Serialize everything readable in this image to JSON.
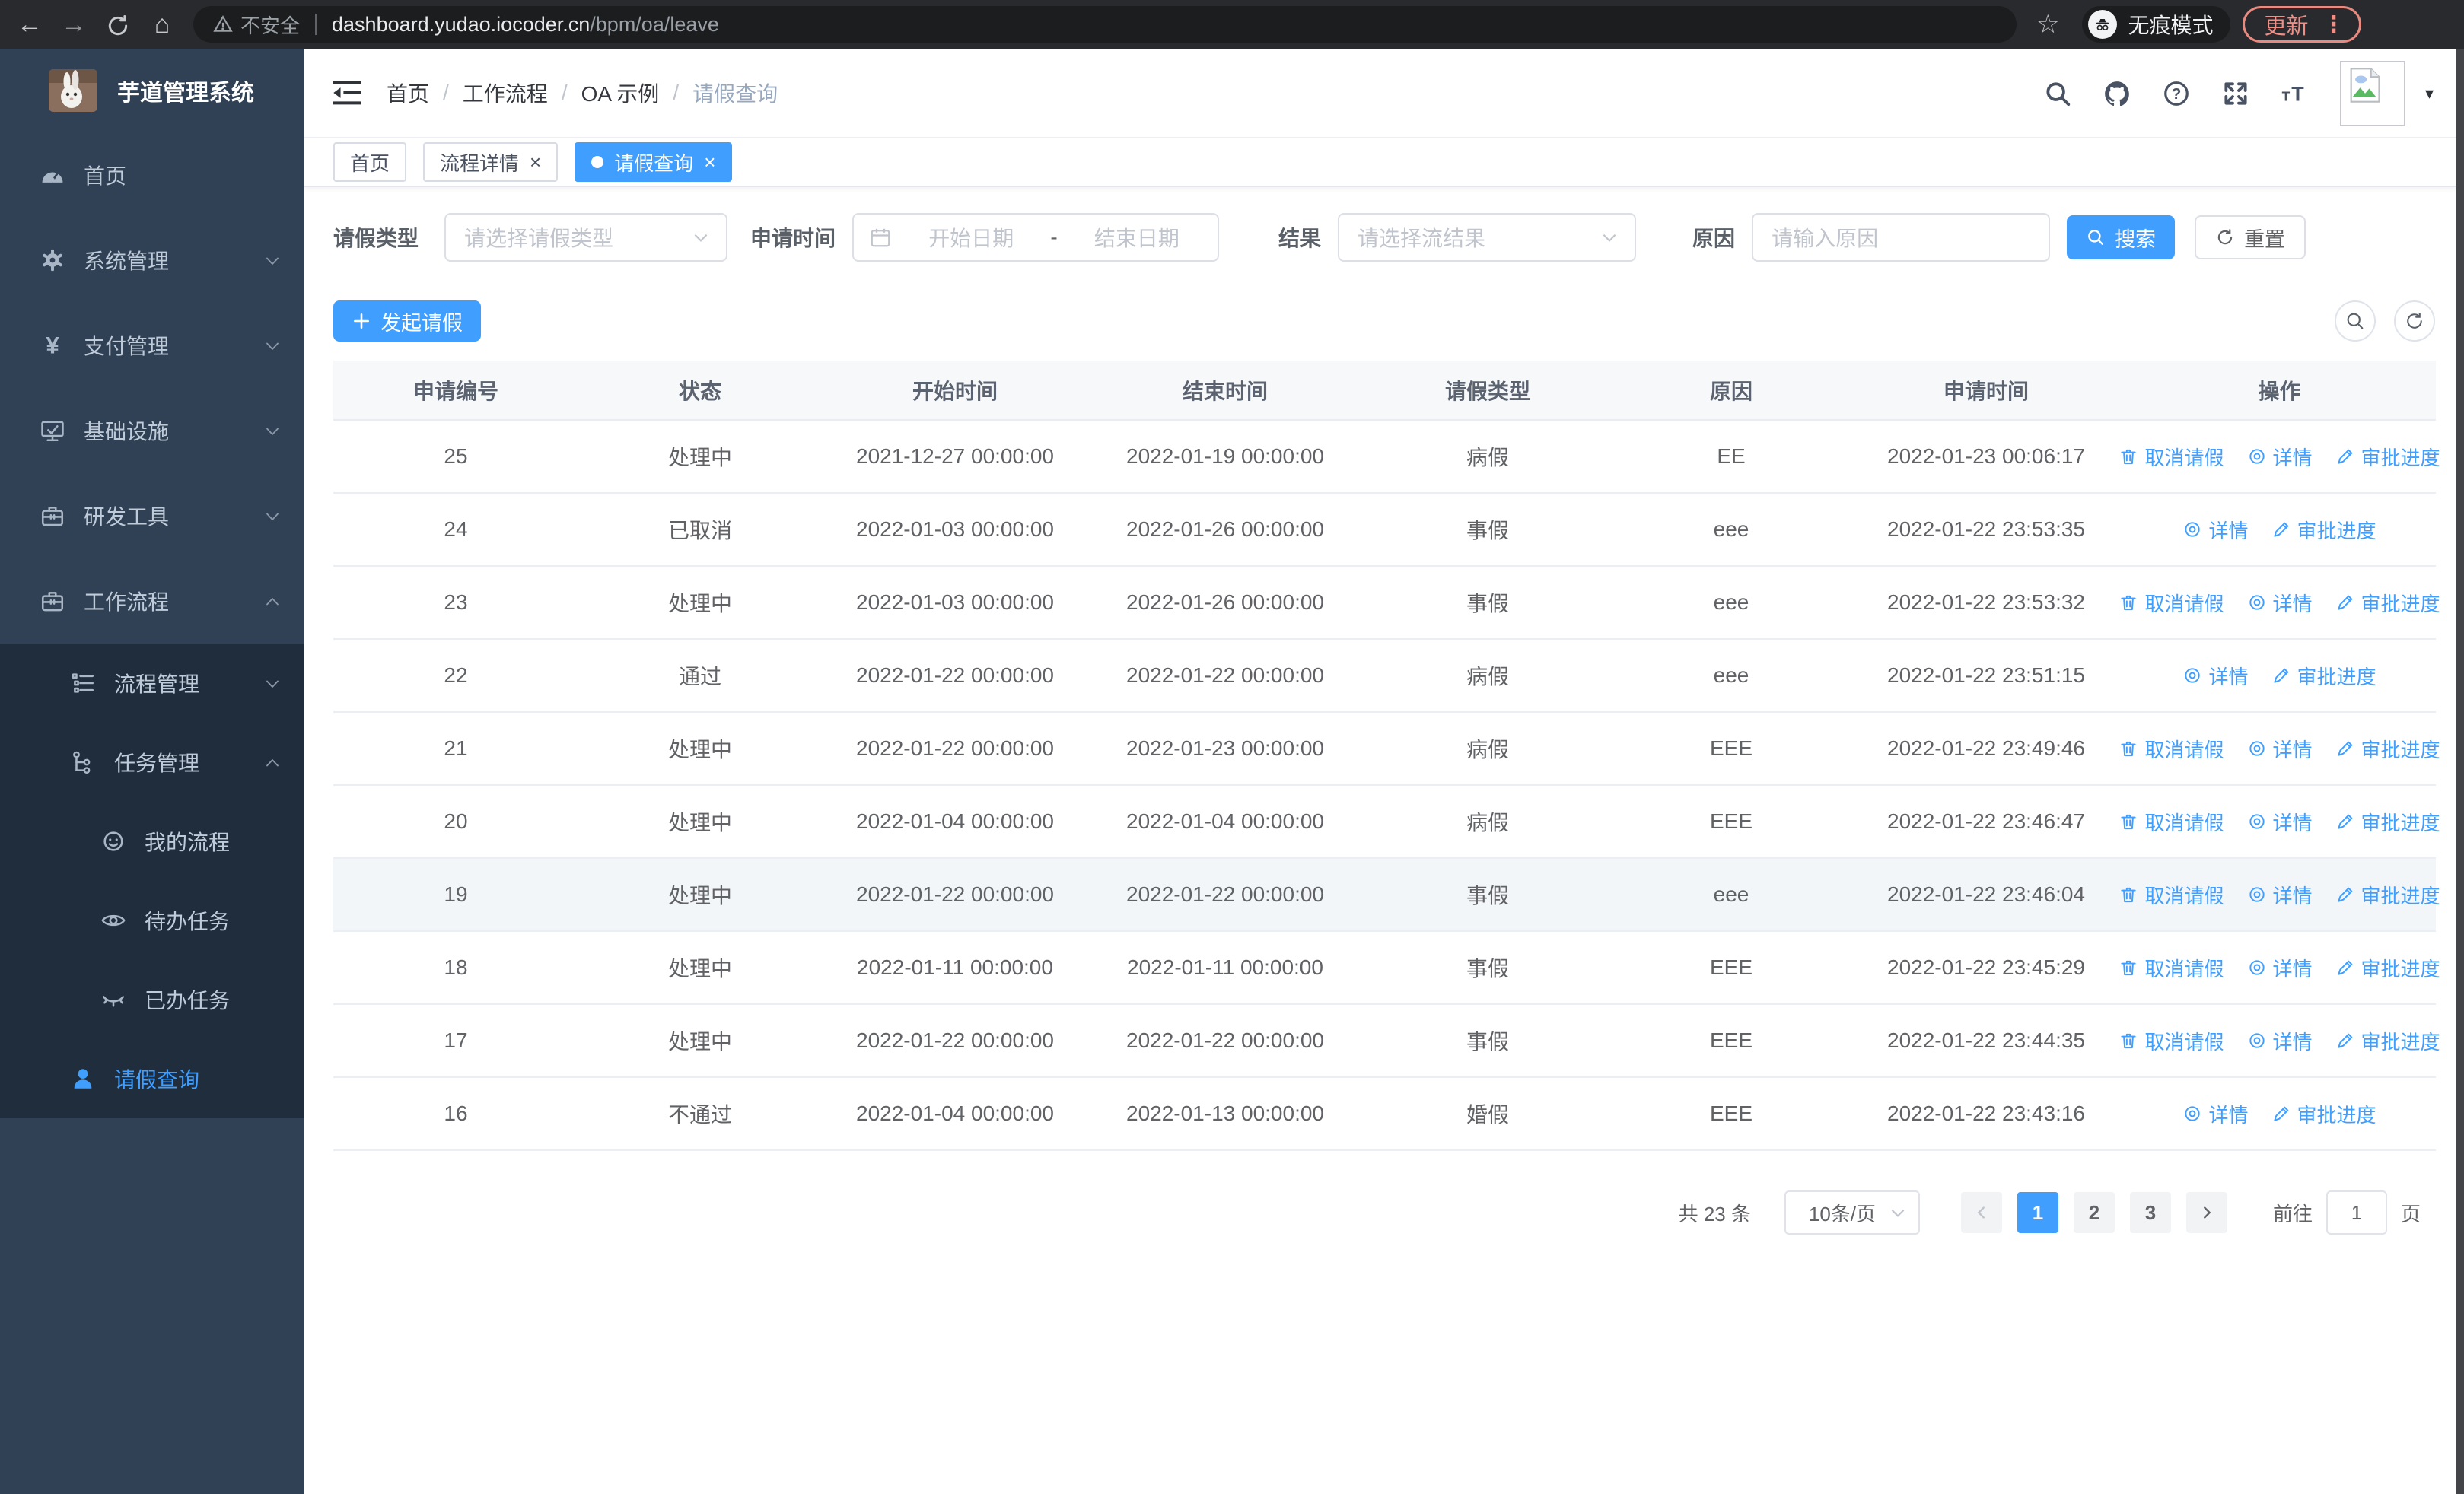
{
  "browser": {
    "security_label": "不安全",
    "url_host": "dashboard.yudao.iocoder.cn",
    "url_path": "/bpm/oa/leave",
    "incognito_label": "无痕模式",
    "update_label": "更新"
  },
  "sidebar": {
    "title": "芋道管理系统",
    "items": [
      {
        "key": "home",
        "label": "首页",
        "icon": "gauge-icon",
        "level": 1
      },
      {
        "key": "system-mgmt",
        "label": "系统管理",
        "icon": "gear-icon",
        "level": 1,
        "chevron": "down"
      },
      {
        "key": "payment-mgmt",
        "label": "支付管理",
        "icon": "yen-icon",
        "level": 1,
        "chevron": "down"
      },
      {
        "key": "infrastructure",
        "label": "基础设施",
        "icon": "monitor-icon",
        "level": 1,
        "chevron": "down"
      },
      {
        "key": "dev-tools",
        "label": "研发工具",
        "icon": "toolbox-icon",
        "level": 1,
        "chevron": "down"
      },
      {
        "key": "workflow",
        "label": "工作流程",
        "icon": "briefcase-icon",
        "level": 1,
        "chevron": "up"
      },
      {
        "key": "process-mgmt",
        "label": "流程管理",
        "icon": "list-tree-icon",
        "level": 2,
        "chevron": "down",
        "dark": true
      },
      {
        "key": "task-mgmt",
        "label": "任务管理",
        "icon": "flow-icon",
        "level": 2,
        "chevron": "up",
        "dark": true
      },
      {
        "key": "my-process",
        "label": "我的流程",
        "icon": "robot-icon",
        "level": 3,
        "dark": true
      },
      {
        "key": "todo-tasks",
        "label": "待办任务",
        "icon": "eye-open-icon",
        "level": 3,
        "dark": true
      },
      {
        "key": "done-tasks",
        "label": "已办任务",
        "icon": "eye-closed-icon",
        "level": 3,
        "dark": true
      },
      {
        "key": "leave-query",
        "label": "请假查询",
        "icon": "user-icon",
        "level": 2,
        "dark": true,
        "active": true
      }
    ]
  },
  "breadcrumb": [
    "首页",
    "工作流程",
    "OA 示例",
    "请假查询"
  ],
  "tabs": [
    {
      "label": "首页",
      "closable": false,
      "active": false
    },
    {
      "label": "流程详情",
      "closable": true,
      "active": false
    },
    {
      "label": "请假查询",
      "closable": true,
      "active": true
    }
  ],
  "filters": {
    "leave_type_label": "请假类型",
    "leave_type_placeholder": "请选择请假类型",
    "apply_time_label": "申请时间",
    "start_placeholder": "开始日期",
    "range_separator": "-",
    "end_placeholder": "结束日期",
    "result_label": "结果",
    "result_placeholder": "请选择流结果",
    "reason_label": "原因",
    "reason_placeholder": "请输入原因",
    "search_label": "搜索",
    "reset_label": "重置"
  },
  "toolbar": {
    "create_label": "发起请假"
  },
  "table": {
    "columns": [
      "申请编号",
      "状态",
      "开始时间",
      "结束时间",
      "请假类型",
      "原因",
      "申请时间",
      "操作"
    ],
    "action_defs": {
      "cancel": {
        "label": "取消请假",
        "icon": "trash-icon"
      },
      "detail": {
        "label": "详情",
        "icon": "view-icon"
      },
      "progress": {
        "label": "审批进度",
        "icon": "edit-icon"
      }
    },
    "rows": [
      {
        "id": "25",
        "status": "处理中",
        "start": "2021-12-27 00:00:00",
        "end": "2022-01-19 00:00:00",
        "type": "病假",
        "reason": "EE",
        "apply_time": "2022-01-23 00:06:17",
        "actions": [
          "cancel",
          "detail",
          "progress"
        ],
        "highlighted": false
      },
      {
        "id": "24",
        "status": "已取消",
        "start": "2022-01-03 00:00:00",
        "end": "2022-01-26 00:00:00",
        "type": "事假",
        "reason": "eee",
        "apply_time": "2022-01-22 23:53:35",
        "actions": [
          "detail",
          "progress"
        ],
        "highlighted": false
      },
      {
        "id": "23",
        "status": "处理中",
        "start": "2022-01-03 00:00:00",
        "end": "2022-01-26 00:00:00",
        "type": "事假",
        "reason": "eee",
        "apply_time": "2022-01-22 23:53:32",
        "actions": [
          "cancel",
          "detail",
          "progress"
        ],
        "highlighted": false
      },
      {
        "id": "22",
        "status": "通过",
        "start": "2022-01-22 00:00:00",
        "end": "2022-01-22 00:00:00",
        "type": "病假",
        "reason": "eee",
        "apply_time": "2022-01-22 23:51:15",
        "actions": [
          "detail",
          "progress"
        ],
        "highlighted": false
      },
      {
        "id": "21",
        "status": "处理中",
        "start": "2022-01-22 00:00:00",
        "end": "2022-01-23 00:00:00",
        "type": "病假",
        "reason": "EEE",
        "apply_time": "2022-01-22 23:49:46",
        "actions": [
          "cancel",
          "detail",
          "progress"
        ],
        "highlighted": false
      },
      {
        "id": "20",
        "status": "处理中",
        "start": "2022-01-04 00:00:00",
        "end": "2022-01-04 00:00:00",
        "type": "病假",
        "reason": "EEE",
        "apply_time": "2022-01-22 23:46:47",
        "actions": [
          "cancel",
          "detail",
          "progress"
        ],
        "highlighted": false
      },
      {
        "id": "19",
        "status": "处理中",
        "start": "2022-01-22 00:00:00",
        "end": "2022-01-22 00:00:00",
        "type": "事假",
        "reason": "eee",
        "apply_time": "2022-01-22 23:46:04",
        "actions": [
          "cancel",
          "detail",
          "progress"
        ],
        "highlighted": true
      },
      {
        "id": "18",
        "status": "处理中",
        "start": "2022-01-11 00:00:00",
        "end": "2022-01-11 00:00:00",
        "type": "事假",
        "reason": "EEE",
        "apply_time": "2022-01-22 23:45:29",
        "actions": [
          "cancel",
          "detail",
          "progress"
        ],
        "highlighted": false
      },
      {
        "id": "17",
        "status": "处理中",
        "start": "2022-01-22 00:00:00",
        "end": "2022-01-22 00:00:00",
        "type": "事假",
        "reason": "EEE",
        "apply_time": "2022-01-22 23:44:35",
        "actions": [
          "cancel",
          "detail",
          "progress"
        ],
        "highlighted": false
      },
      {
        "id": "16",
        "status": "不通过",
        "start": "2022-01-04 00:00:00",
        "end": "2022-01-13 00:00:00",
        "type": "婚假",
        "reason": "EEE",
        "apply_time": "2022-01-22 23:43:16",
        "actions": [
          "detail",
          "progress"
        ],
        "highlighted": false
      }
    ]
  },
  "pagination": {
    "total_label": "共 23 条",
    "page_size_label": "10条/页",
    "pages": [
      "1",
      "2",
      "3"
    ],
    "active_page": "1",
    "goto_label": "前往",
    "goto_value": "1",
    "page_unit_label": "页"
  },
  "colors": {
    "accent": "#409eff",
    "sidebar_bg": "#304156",
    "submenu_bg": "#1f2d3d",
    "update_pill": "#ee9088"
  }
}
